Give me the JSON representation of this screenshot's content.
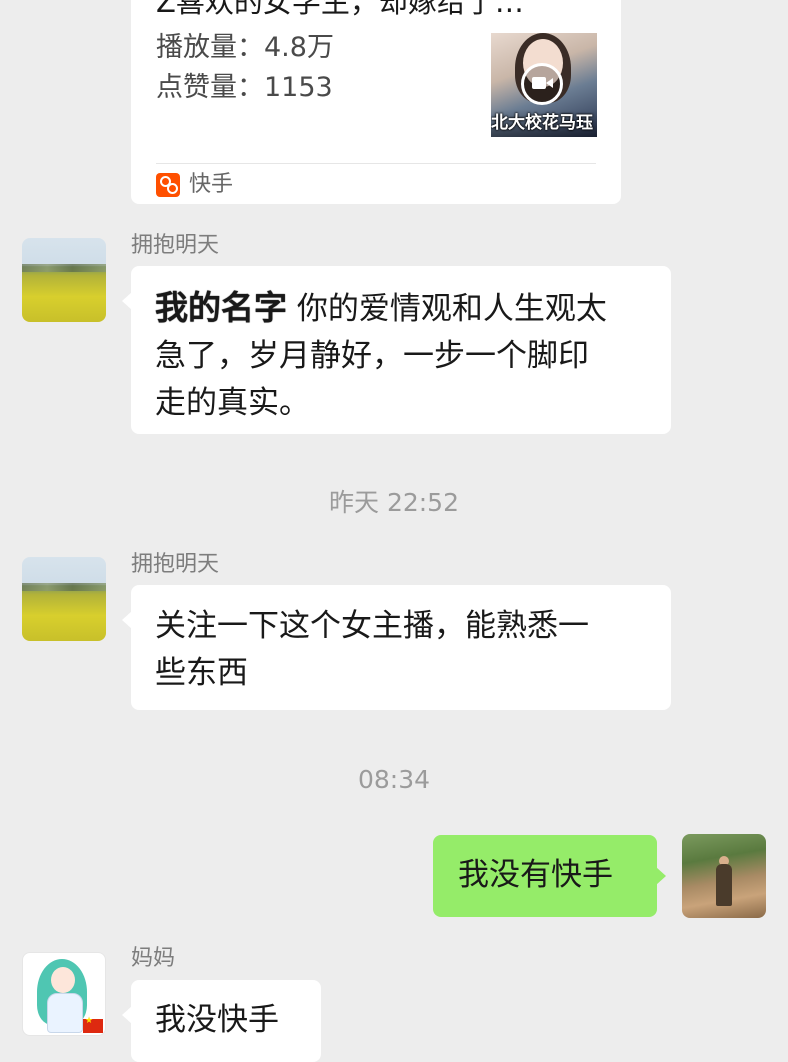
{
  "share_card": {
    "title": "Z喜欢的女学生，却嫁给了…",
    "plays_label": "播放量：",
    "plays_value": "4.8万",
    "likes_label": "点赞量：",
    "likes_value": "1153",
    "thumbnail_caption": "北大校花马珏",
    "thumbnail_icon": "video-camera-icon",
    "source_icon": "kuaishou-logo-icon",
    "source_label": "快手",
    "brand_color": "#ff5000"
  },
  "messages": [
    {
      "sender": "拥抱明天",
      "mention": "我的名字",
      "text_line1": " 你的爱情观和人生观太",
      "text_line2": "急了，岁月静好，一步一个脚印",
      "text_line3": "走的真实。"
    },
    {
      "sender": "拥抱明天",
      "text_line1": "关注一下这个女主播，能熟悉一",
      "text_line2": "些东西"
    },
    {
      "text": "我没有快手"
    },
    {
      "sender": "妈妈",
      "text": "我没快手"
    }
  ],
  "timestamps": [
    "昨天 22:52",
    "08:34"
  ],
  "colors": {
    "background": "#ededed",
    "bubble_incoming": "#ffffff",
    "bubble_outgoing": "#95ec69"
  }
}
